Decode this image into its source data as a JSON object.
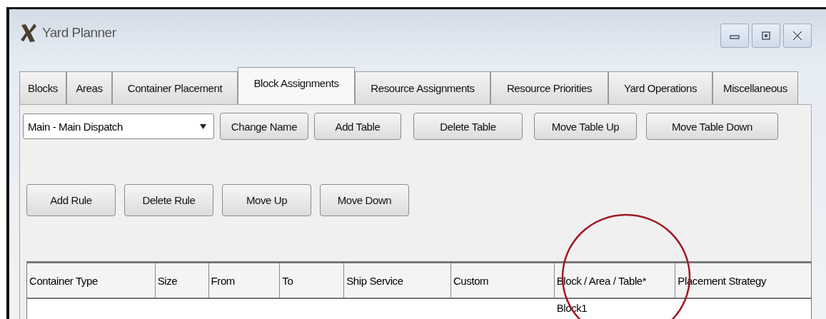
{
  "window": {
    "title": "Yard Planner"
  },
  "tabs": [
    {
      "label": "Blocks",
      "selected": false
    },
    {
      "label": "Areas",
      "selected": false
    },
    {
      "label": "Container Placement",
      "selected": false
    },
    {
      "label": "Block Assignments",
      "selected": true
    },
    {
      "label": "Resource Assignments",
      "selected": false
    },
    {
      "label": "Resource Priorities",
      "selected": false
    },
    {
      "label": "Yard Operations",
      "selected": false
    },
    {
      "label": "Miscellaneous",
      "selected": false
    }
  ],
  "table_select": {
    "value": "Main - Main Dispatch"
  },
  "table_buttons": [
    "Change Name",
    "Add Table",
    "Delete Table",
    "Move Table Up",
    "Move Table Down"
  ],
  "rule_buttons": [
    "Add Rule",
    "Delete Rule",
    "Move Up",
    "Move Down"
  ],
  "table": {
    "columns": [
      "Container Type",
      "Size",
      "From",
      "To",
      "Ship Service",
      "Custom",
      "Block / Area / Table*",
      "Placement Strategy"
    ],
    "rows": [
      {
        "cells": [
          null,
          null,
          null,
          null,
          null,
          null,
          "Block1",
          null
        ]
      }
    ]
  }
}
